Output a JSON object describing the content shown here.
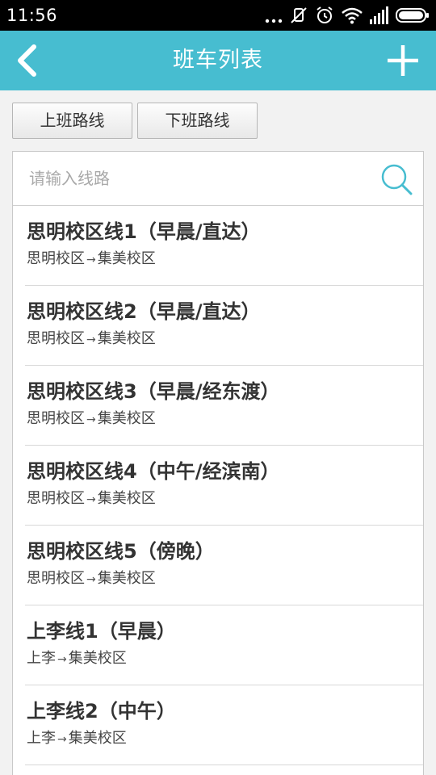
{
  "status_bar": {
    "time": "11:56",
    "icons": [
      "dots-icon",
      "mute-icon",
      "alarm-icon",
      "wifi-icon",
      "signal-icon",
      "battery-icon"
    ]
  },
  "header": {
    "title": "班车列表",
    "back_icon": "chevron-left-icon",
    "add_icon": "plus-icon",
    "background": "#47bdd0"
  },
  "tabs": [
    {
      "label": "上班路线"
    },
    {
      "label": "下班路线"
    }
  ],
  "search": {
    "placeholder": "请输入线路",
    "icon": "search-icon"
  },
  "routes": [
    {
      "title": "思明校区线1（早晨/直达）",
      "from": "思明校区",
      "arrow": "→",
      "to": "集美校区"
    },
    {
      "title": "思明校区线2（早晨/直达）",
      "from": "思明校区",
      "arrow": "→",
      "to": "集美校区"
    },
    {
      "title": "思明校区线3（早晨/经东渡）",
      "from": "思明校区",
      "arrow": "→",
      "to": "集美校区"
    },
    {
      "title": "思明校区线4（中午/经滨南）",
      "from": "思明校区",
      "arrow": "→",
      "to": "集美校区"
    },
    {
      "title": "思明校区线5（傍晚）",
      "from": "思明校区",
      "arrow": "→",
      "to": "集美校区"
    },
    {
      "title": "上李线1（早晨）",
      "from": "上李",
      "arrow": "→",
      "to": "集美校区"
    },
    {
      "title": "上李线2（中午）",
      "from": "上李",
      "arrow": "→",
      "to": "集美校区"
    }
  ]
}
